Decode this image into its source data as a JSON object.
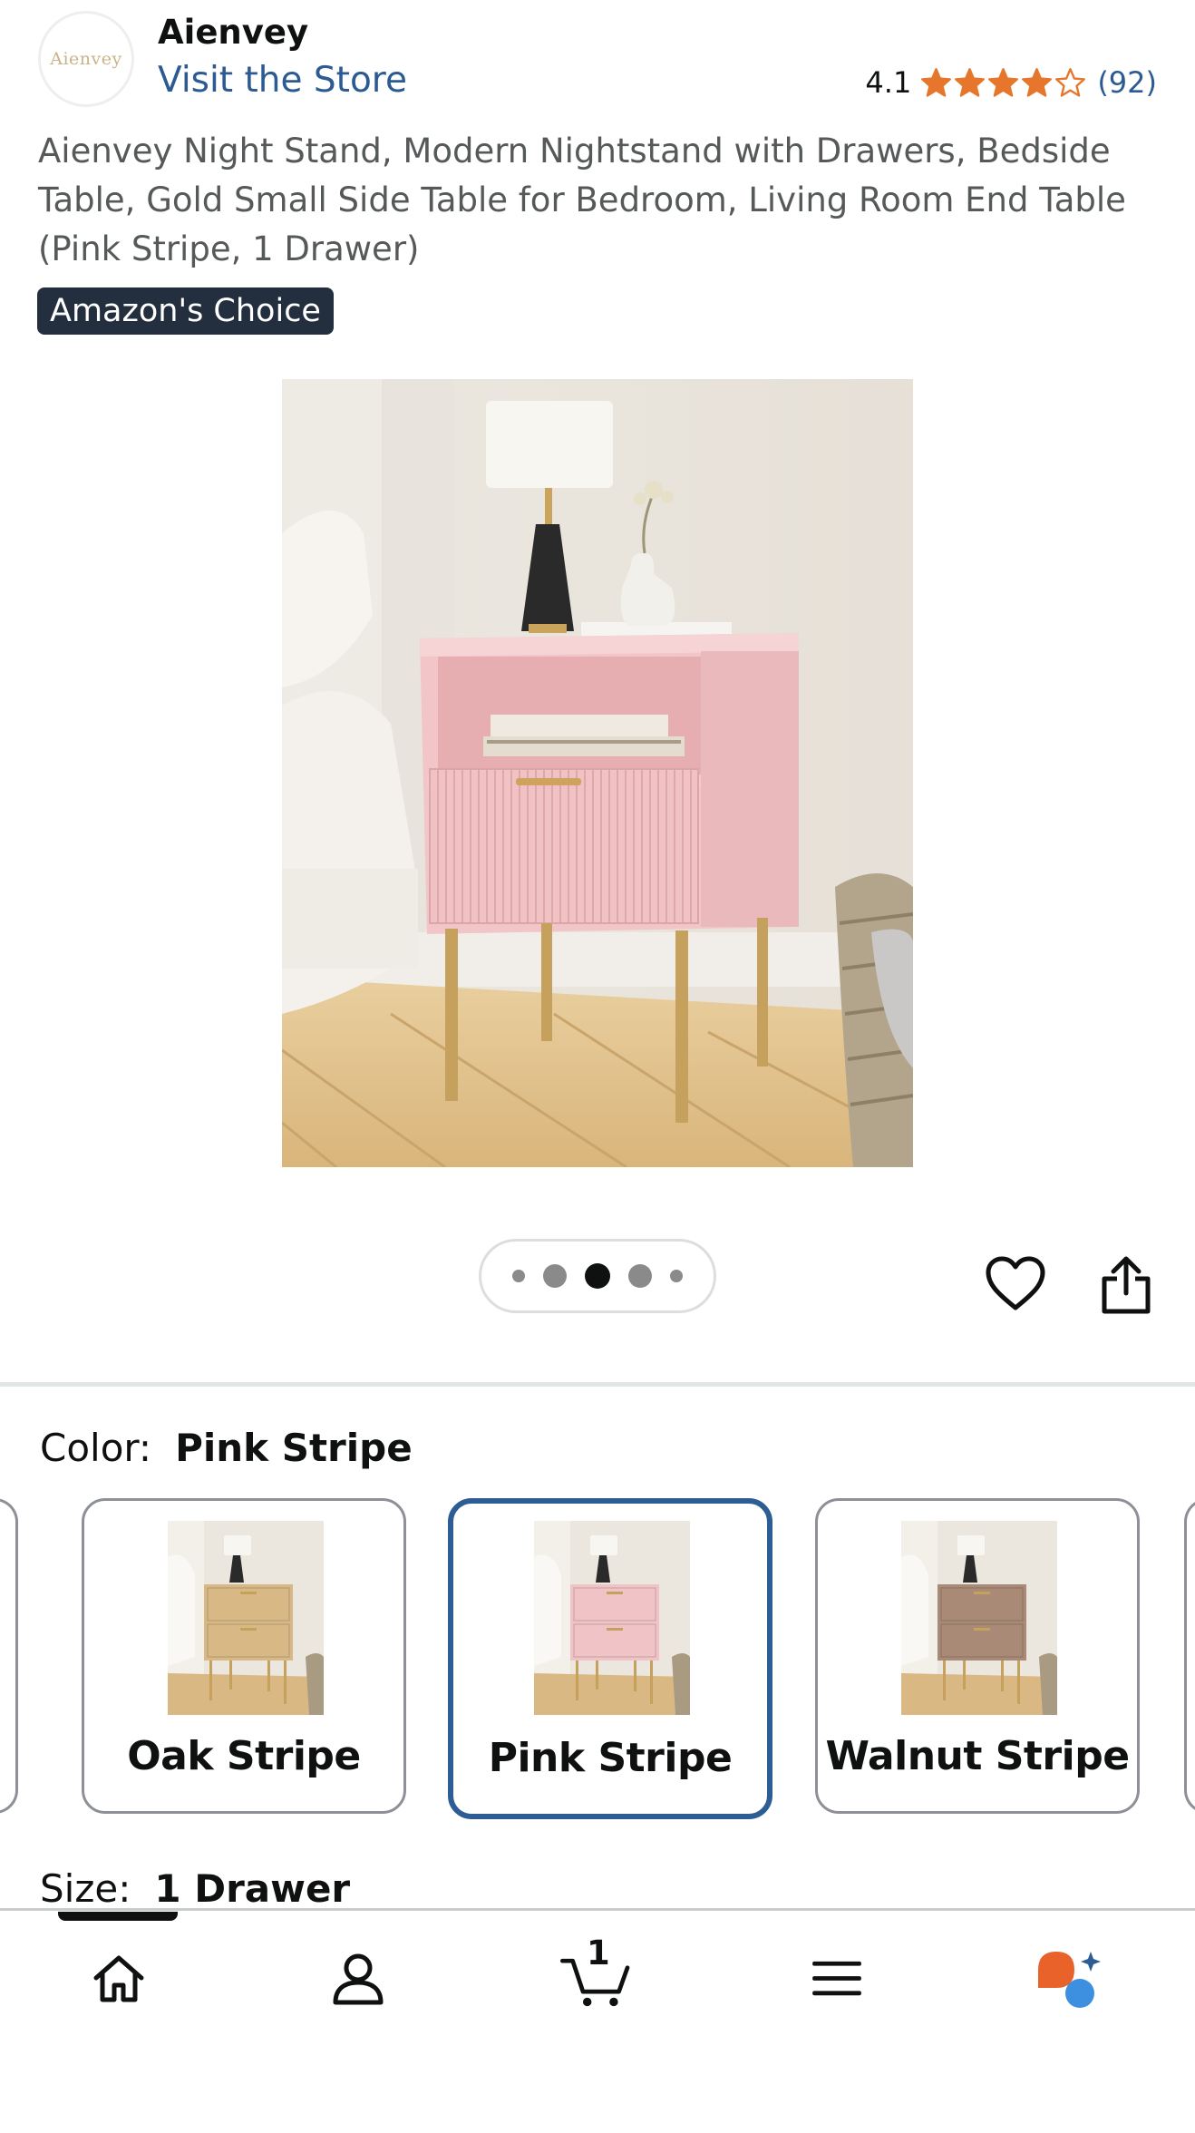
{
  "header": {
    "brand_logo_text": "Aienvey",
    "brand_name": "Aienvey",
    "visit_store": "Visit the Store",
    "rating_value": "4.1",
    "rating_stars": 4.1,
    "review_count": "(92)"
  },
  "product": {
    "title": "Aienvey Night Stand, Modern Nightstand with Drawers, Bedside Table, Gold Small Side Table for Bedroom, Living Room End Table (Pink Stripe, 1 Drawer)",
    "badge": "Amazon's Choice"
  },
  "gallery": {
    "image_count": 5,
    "active_index": 2
  },
  "color": {
    "label": "Color:",
    "selected": "Pink Stripe",
    "options": [
      {
        "label": "Oak Stripe",
        "cabinet_color": "#d8b985"
      },
      {
        "label": "Pink Stripe",
        "cabinet_color": "#f0c4c6"
      },
      {
        "label": "Walnut Stripe",
        "cabinet_color": "#a98a77"
      }
    ]
  },
  "size": {
    "label": "Size:",
    "selected": "1 Drawer"
  },
  "nav": {
    "cart_count": "1",
    "items": [
      "home-icon",
      "account-icon",
      "cart-icon",
      "menu-icon",
      "rufus-icon"
    ]
  },
  "colors": {
    "link": "#2c5a92",
    "star": "#e5762b",
    "badge_bg": "#232f3e",
    "selected_border": "#2d5d94"
  }
}
